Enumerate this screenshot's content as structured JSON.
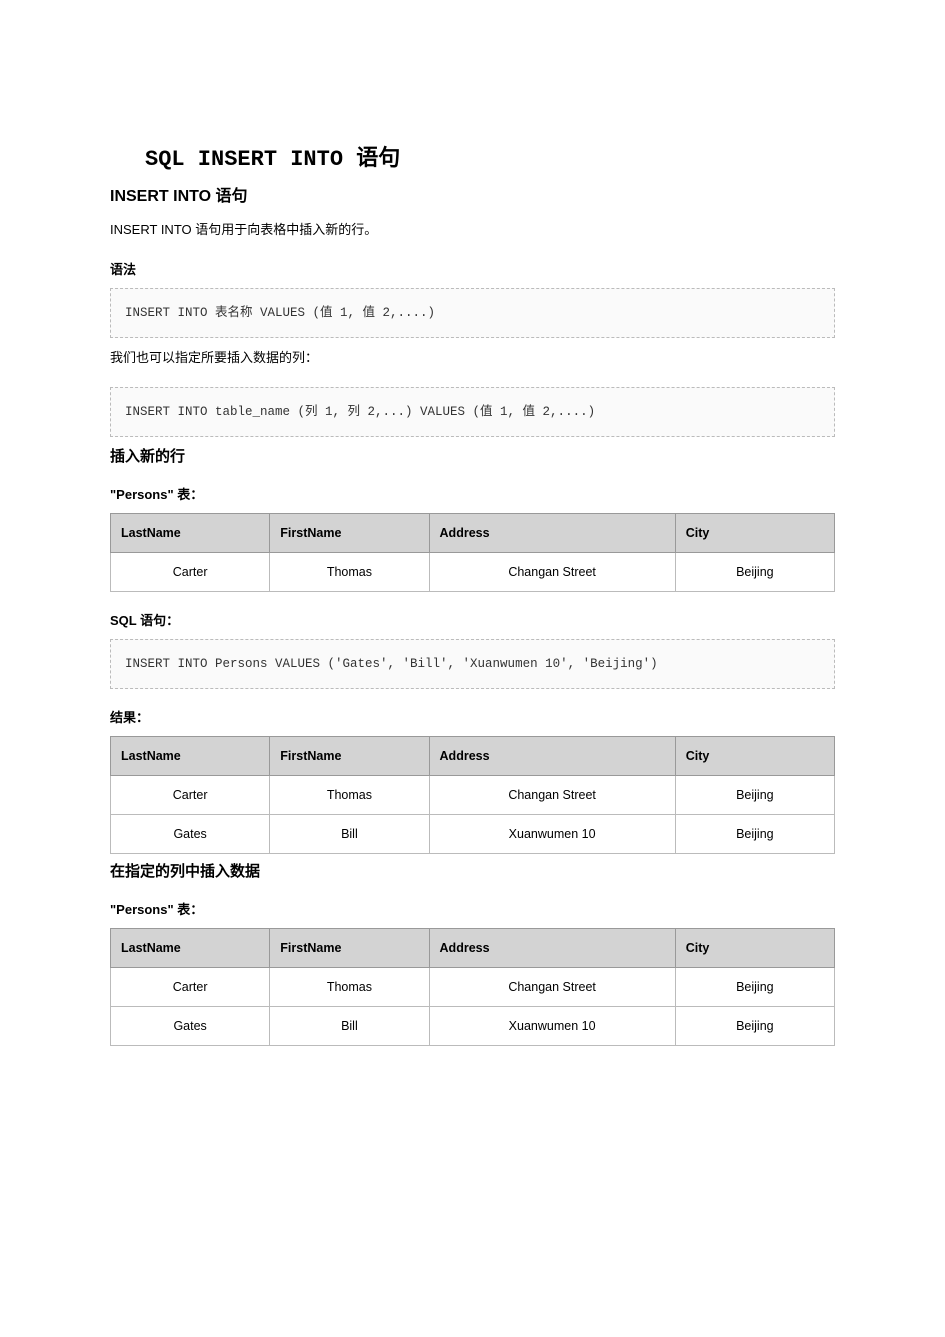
{
  "title": "SQL INSERT INTO 语句",
  "h2_1": "INSERT INTO 语句",
  "p1": "INSERT INTO 语句用于向表格中插入新的行。",
  "h3_syntax": "语法",
  "code1": "INSERT INTO 表名称 VALUES (值 1, 值 2,....)",
  "p2": "我们也可以指定所要插入数据的列：",
  "code2": "INSERT INTO table_name (列 1, 列 2,...) VALUES (值 1, 值 2,....)",
  "h2_insert_row": "插入新的行",
  "h3_persons_1": "\"Persons\" 表：",
  "h3_sql": "SQL 语句：",
  "code3": "INSERT INTO Persons VALUES ('Gates', 'Bill', 'Xuanwumen 10', 'Beijing')",
  "h3_result": "结果：",
  "h2_insert_col": "在指定的列中插入数据",
  "h3_persons_2": "\"Persons\" 表：",
  "columns": {
    "last": "LastName",
    "first": "FirstName",
    "addr": "Address",
    "city": "City"
  },
  "table1": {
    "rows": [
      {
        "last": "Carter",
        "first": "Thomas",
        "addr": "Changan Street",
        "city": "Beijing"
      }
    ]
  },
  "table2": {
    "rows": [
      {
        "last": "Carter",
        "first": "Thomas",
        "addr": "Changan Street",
        "city": "Beijing"
      },
      {
        "last": "Gates",
        "first": "Bill",
        "addr": "Xuanwumen 10",
        "city": "Beijing"
      }
    ]
  },
  "table3": {
    "rows": [
      {
        "last": "Carter",
        "first": "Thomas",
        "addr": "Changan Street",
        "city": "Beijing"
      },
      {
        "last": "Gates",
        "first": "Bill",
        "addr": "Xuanwumen 10",
        "city": "Beijing"
      }
    ]
  }
}
